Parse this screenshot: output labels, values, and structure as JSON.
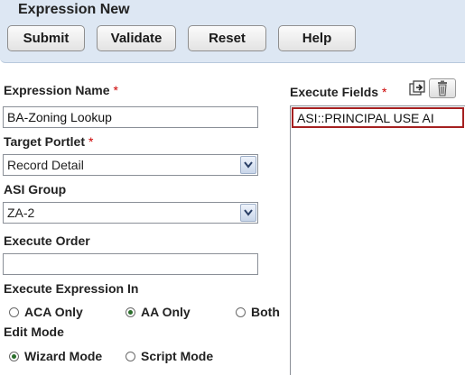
{
  "header": {
    "title": "Expression New",
    "buttons": {
      "submit": "Submit",
      "validate": "Validate",
      "reset": "Reset",
      "help": "Help"
    }
  },
  "form": {
    "expression_name": {
      "label": "Expression Name",
      "required_mark": "*",
      "value": "BA-Zoning Lookup"
    },
    "target_portlet": {
      "label": "Target Portlet",
      "required_mark": "*",
      "value": "Record Detail"
    },
    "asi_group": {
      "label": "ASI Group",
      "value": "ZA-2"
    },
    "execute_order": {
      "label": "Execute Order",
      "value": ""
    },
    "execute_expression_in": {
      "label": "Execute Expression In",
      "options": [
        "ACA Only",
        "AA Only",
        "Both"
      ],
      "selected": "AA Only"
    },
    "edit_mode": {
      "label": "Edit Mode",
      "options": [
        "Wizard Mode",
        "Script Mode"
      ],
      "selected": "Wizard Mode"
    }
  },
  "execute_fields": {
    "label": "Execute Fields",
    "required_mark": "*",
    "icons": [
      "select-fields-icon",
      "delete-icon"
    ],
    "items": [
      "ASI::PRINCIPAL USE AI"
    ]
  },
  "colors": {
    "header_bg": "#dde7f3",
    "required": "#cc0000",
    "highlight_border": "#a52020",
    "radio_dot": "#2b6e2b"
  }
}
